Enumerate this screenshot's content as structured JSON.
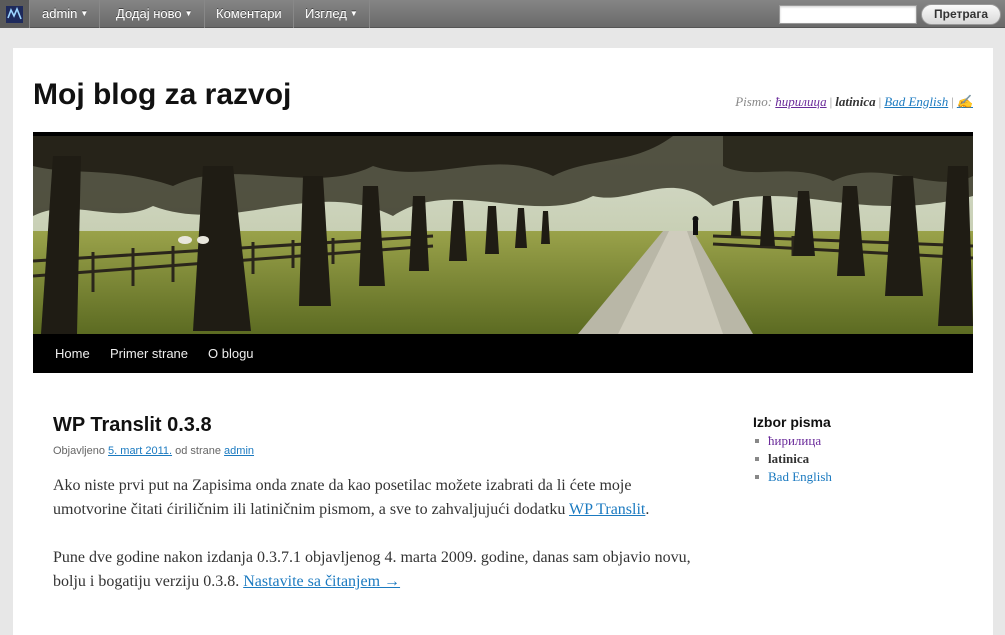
{
  "adminbar": {
    "items": [
      {
        "label": "admin"
      },
      {
        "label": "Додај ново"
      },
      {
        "label": "Коментари"
      },
      {
        "label": "Изглед"
      }
    ],
    "search_value": "",
    "search_button": "Претрага"
  },
  "site": {
    "title": "Moj blog za razvoj",
    "script_label": "Pismo:",
    "scripts": [
      "ћирилица",
      "latinica",
      "Bad English",
      "✍"
    ]
  },
  "nav": [
    "Home",
    "Primer strane",
    "O blogu"
  ],
  "post": {
    "title": "WP Translit 0.3.8",
    "meta_prefix": "Objavljeno",
    "date": "5. mart 2011.",
    "meta_by": "od strane",
    "author": "admin",
    "p1_text": "Ako niste prvi put na Zapisima onda znate da kao posetilac možete izabrati da li ćete moje umotvorine čitati ćiriličnim ili latiničnim pismom, a sve to zahvaljujući dodatku ",
    "p1_link": "WP Translit",
    "p1_end": ".",
    "p2_text": "Pune dve godine nakon izdanja 0.3.7.1 objavljenog 4. marta 2009. godine, danas sam objavio novu, bolju i bogatiju verziju 0.3.8. ",
    "p2_link": "Nastavite sa čitanjem →"
  },
  "sidebar": {
    "title": "Izbor pisma",
    "items": [
      "ћирилица",
      "latinica",
      "Bad English"
    ]
  },
  "colors": {
    "link": "#1b7ac0",
    "visited": "#6a2a9a",
    "adminbar": "#6f6f6f",
    "nav": "#000000"
  }
}
